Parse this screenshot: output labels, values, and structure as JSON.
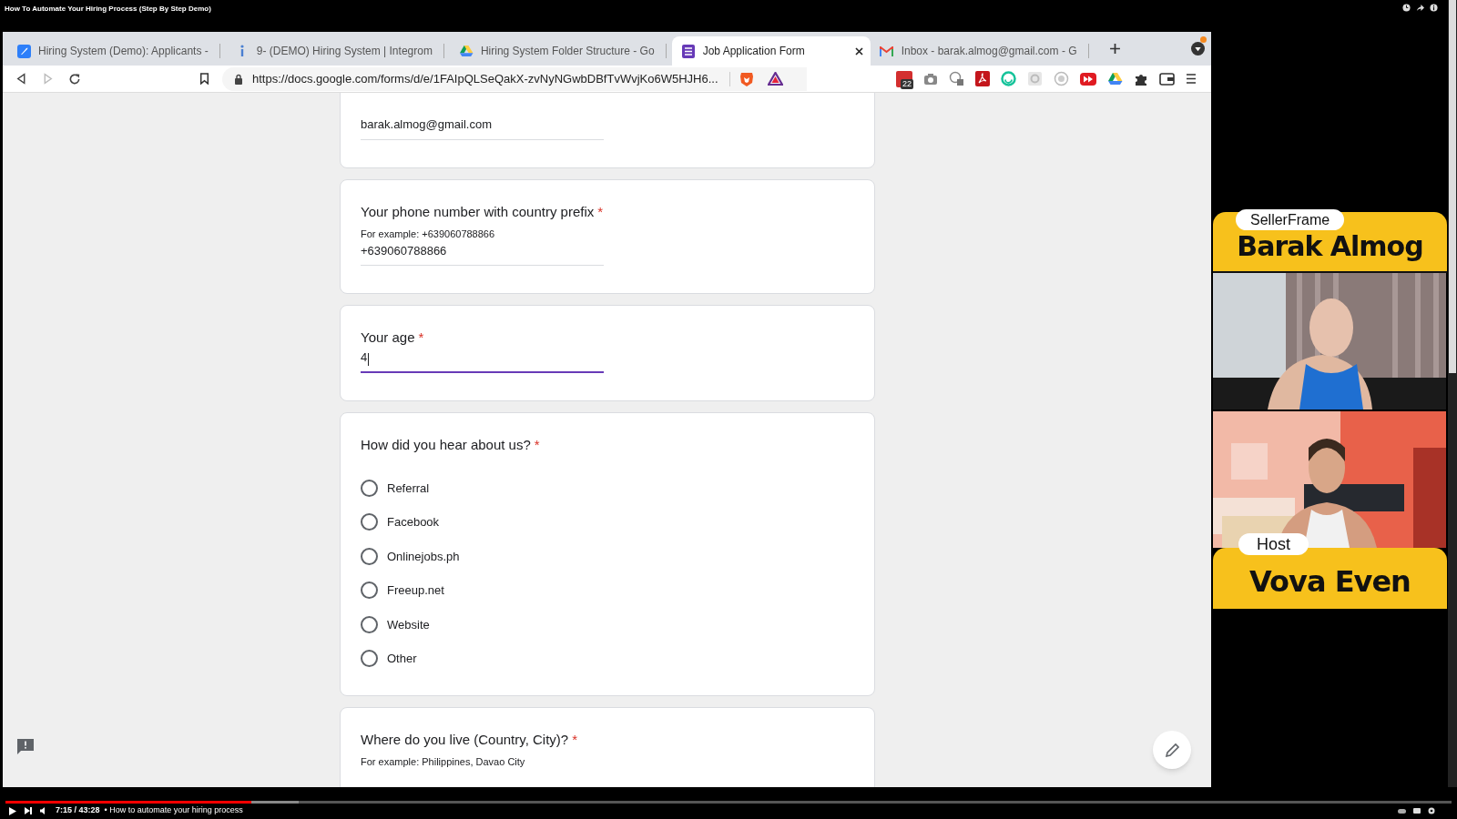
{
  "video_title": "How To Automate Your Hiring Process (Step By Step Demo)",
  "browser": {
    "tabs": [
      {
        "label": "Hiring System (Demo): Applicants -",
        "selected": false
      },
      {
        "label": "9- (DEMO) Hiring System | Integrom",
        "selected": false
      },
      {
        "label": "Hiring System Folder Structure - Go",
        "selected": false
      },
      {
        "label": "Job Application Form",
        "selected": true
      },
      {
        "label": "Inbox - barak.almog@gmail.com - G",
        "selected": false
      }
    ],
    "url": "https://docs.google.com/forms/d/e/1FAIpQLSeQakX-zvNyNGwbDBfTvWvjKo6W5HJH6...",
    "extension_badge": "22"
  },
  "form": {
    "questions": [
      {
        "kind": "text",
        "value": "barak.almog@gmail.com",
        "focused": false
      },
      {
        "kind": "text",
        "title": "Your phone number with country prefix",
        "required_mark": "*",
        "hint": "For example: +639060788866",
        "value": "+639060788866",
        "focused": false
      },
      {
        "kind": "text",
        "title": "Your age",
        "required_mark": "*",
        "value": "4",
        "focused": true
      },
      {
        "kind": "choice",
        "title": "How did you hear about us?",
        "required_mark": "*",
        "options": [
          {
            "label": "Referral",
            "selected": false
          },
          {
            "label": "Facebook",
            "selected": false
          },
          {
            "label": "Onlinejobs.ph",
            "selected": false
          },
          {
            "label": "Freeup.net",
            "selected": false
          },
          {
            "label": "Website",
            "selected": false
          },
          {
            "label": "Other",
            "selected": false
          }
        ]
      },
      {
        "kind": "text",
        "title": "Where do you live (Country, City)?",
        "required_mark": "*",
        "hint": "For example: Philippines, Davao City"
      }
    ]
  },
  "overlay": {
    "guest": {
      "tag": "SellerFrame",
      "name": "Barak Almog"
    },
    "host": {
      "tag": "Host",
      "name": "Vova Even"
    }
  },
  "player": {
    "time": "7:15 / 43:28",
    "chapter": "• How to automate your hiring process",
    "level": 0.17
  }
}
